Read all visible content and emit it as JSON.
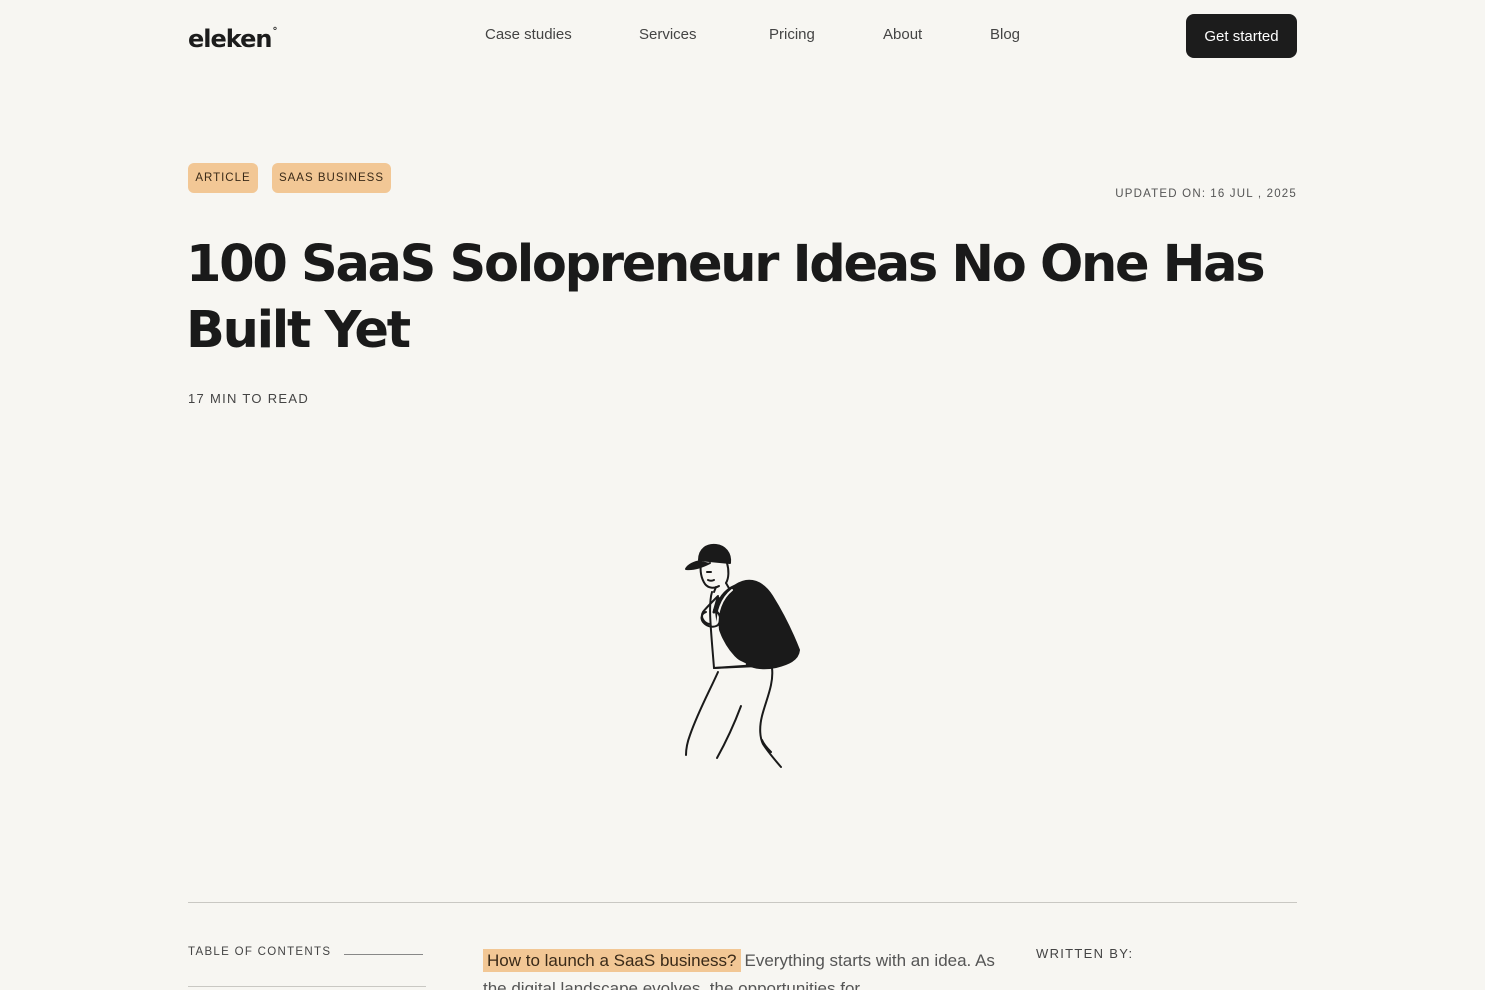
{
  "header": {
    "logo": "eleken",
    "logo_mark": "°",
    "nav": [
      {
        "label": "Case studies"
      },
      {
        "label": "Services"
      },
      {
        "label": "Pricing"
      },
      {
        "label": "About"
      },
      {
        "label": "Blog"
      }
    ],
    "cta_label": "Get started"
  },
  "article": {
    "tags": [
      "ARTICLE",
      "SAAS BUSINESS"
    ],
    "updated_label": "UPDATED ON:",
    "updated_date": "16 JUL , 2025",
    "title": "100 SaaS Solopreneur Ideas No One Has Built Yet",
    "read_time": "17 MIN TO READ",
    "illustration": "man-with-backpack-illustration"
  },
  "body": {
    "toc_label": "TABLE OF CONTENTS",
    "intro_link": "How to launch a SaaS business?",
    "intro_text": "Everything starts with an idea. As the digital landscape evolves, the opportunities for",
    "written_by_label": "WRITTEN BY:"
  },
  "colors": {
    "background": "#f7f6f2",
    "accent": "#f2c795",
    "text": "#1c1c1c",
    "button": "#1c1c1c"
  }
}
